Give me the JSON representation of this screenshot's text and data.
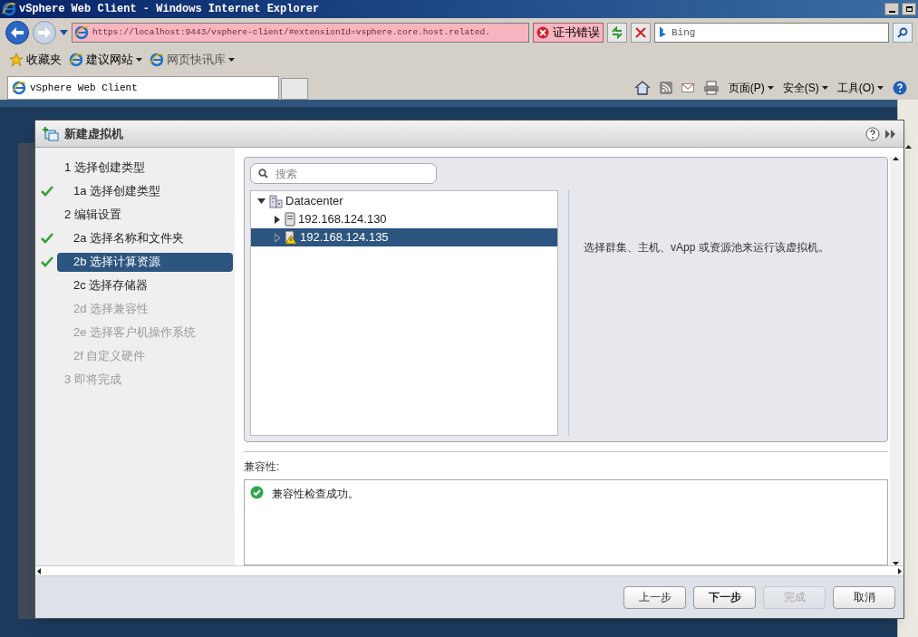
{
  "browser": {
    "title": "vSphere Web Client - Windows Internet Explorer",
    "address": "https://localhost:9443/vsphere-client/#extensionId=vsphere.core.host.related.",
    "cert_error": "证书错误",
    "search_placeholder": "Bing",
    "favorites": [
      {
        "label": "收藏夹",
        "kind": "star"
      },
      {
        "label": "建议网站",
        "kind": "ie"
      },
      {
        "label": "网页快讯库",
        "kind": "ie"
      }
    ],
    "tab": "vSphere Web Client",
    "commands": [
      "页面(P)",
      "安全(S)",
      "工具(O)"
    ]
  },
  "dialog": {
    "title": "新建虚拟机",
    "steps": [
      {
        "number": "1",
        "label": "选择创建类型",
        "checked": false,
        "selected": false,
        "disabled": false,
        "children": [
          {
            "number": "1a",
            "label": "选择创建类型",
            "checked": true,
            "selected": false,
            "disabled": false
          }
        ]
      },
      {
        "number": "2",
        "label": "编辑设置",
        "checked": false,
        "selected": false,
        "disabled": false,
        "children": [
          {
            "number": "2a",
            "label": "选择名称和文件夹",
            "checked": true,
            "selected": false,
            "disabled": false
          },
          {
            "number": "2b",
            "label": "选择计算资源",
            "checked": true,
            "selected": true,
            "disabled": false
          },
          {
            "number": "2c",
            "label": "选择存储器",
            "checked": false,
            "selected": false,
            "disabled": false
          },
          {
            "number": "2d",
            "label": "选择兼容性",
            "checked": false,
            "selected": false,
            "disabled": true
          },
          {
            "number": "2e",
            "label": "选择客户机操作系统",
            "checked": false,
            "selected": false,
            "disabled": true
          },
          {
            "number": "2f",
            "label": "自定义硬件",
            "checked": false,
            "selected": false,
            "disabled": true
          }
        ]
      },
      {
        "number": "3",
        "label": "即将完成",
        "checked": false,
        "selected": false,
        "disabled": true
      }
    ],
    "search_placeholder": "搜索",
    "tree": [
      {
        "label": "Datacenter",
        "kind": "datacenter",
        "expanded": true,
        "selected": false,
        "children": [
          {
            "label": "192.168.124.130",
            "kind": "host",
            "expanded": false,
            "selected": false
          },
          {
            "label": "192.168.124.135",
            "kind": "host-warning",
            "expanded": false,
            "selected": true
          }
        ]
      }
    ],
    "info": "选择群集、主机、vApp 或资源池来运行该虚拟机。",
    "compatibility_label": "兼容性:",
    "compatibility_message": "兼容性检查成功。",
    "buttons": [
      {
        "label": "上一步",
        "disabled": false,
        "primary": false
      },
      {
        "label": "下一步",
        "disabled": false,
        "primary": true
      },
      {
        "label": "完成",
        "disabled": true,
        "primary": false
      },
      {
        "label": "取消",
        "disabled": false,
        "primary": false
      }
    ]
  }
}
